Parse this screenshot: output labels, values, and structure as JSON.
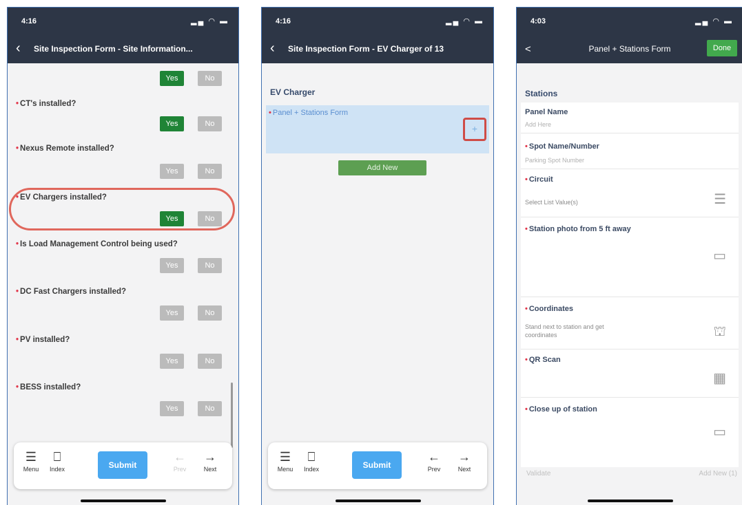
{
  "status_bar": {
    "phone1_time": "4:16",
    "phone2_time": "4:16",
    "phone3_time": "4:03"
  },
  "phone1": {
    "nav_title": "Site Inspection Form - Site Information...",
    "yes_label": "Yes",
    "no_label": "No",
    "questions": [
      {
        "label": "CT's installed?",
        "selected": "Yes"
      },
      {
        "label": "Nexus Remote installed?",
        "selected": ""
      },
      {
        "label": "EV Chargers installed?",
        "selected": "Yes"
      },
      {
        "label": "Is Load Management Control being used?",
        "selected": ""
      },
      {
        "label": "DC Fast Chargers installed?",
        "selected": ""
      },
      {
        "label": "PV installed?",
        "selected": ""
      },
      {
        "label": "BESS installed?",
        "selected": ""
      }
    ],
    "toolbar": {
      "menu": "Menu",
      "index": "Index",
      "submit": "Submit",
      "prev": "Prev",
      "next": "Next"
    }
  },
  "phone2": {
    "nav_title": "Site Inspection Form - EV Charger of 13",
    "section_title": "EV Charger",
    "subform_label": "Panel + Stations Form",
    "plus_glyph": "+",
    "add_new": "Add New",
    "toolbar": {
      "menu": "Menu",
      "index": "Index",
      "submit": "Submit",
      "prev": "Prev",
      "next": "Next"
    }
  },
  "phone3": {
    "nav_back": "<",
    "nav_title": "Panel + Stations Form",
    "done": "Done",
    "section_title": "Stations",
    "fields": {
      "panel_name": {
        "label": "Panel Name",
        "placeholder": "Add Here"
      },
      "spot_name": {
        "label": "Spot Name/Number",
        "placeholder": "Parking Spot Number"
      },
      "circuit": {
        "label": "Circuit",
        "value": "Select List Value(s)"
      },
      "station_photo": {
        "label": "Station photo from 5 ft away"
      },
      "coordinates": {
        "label": "Coordinates",
        "value_line1": "Stand next to station and get",
        "value_line2": "coordinates"
      },
      "qr_scan": {
        "label": "QR Scan"
      },
      "close_up": {
        "label": "Close up of station"
      }
    },
    "bottom_left": "Validate",
    "bottom_right": "Add New (1)"
  },
  "icons": [
    "back-chevron-icon",
    "hamburger-menu-icon",
    "bookmark-icon",
    "arrow-left-icon",
    "arrow-right-icon",
    "plus-icon",
    "list-icon",
    "image-icon",
    "location-icon",
    "qr-code-icon"
  ],
  "colors": {
    "header": "#2d3646",
    "yes_active": "#1f8436",
    "button_inactive": "#bbbbbb",
    "submit": "#4aa8f0",
    "required_star": "#e2364a",
    "highlight": "#e0675c",
    "subform_bg": "#cfe3f5",
    "add_new": "#5d9f52",
    "done": "#42a94d"
  }
}
